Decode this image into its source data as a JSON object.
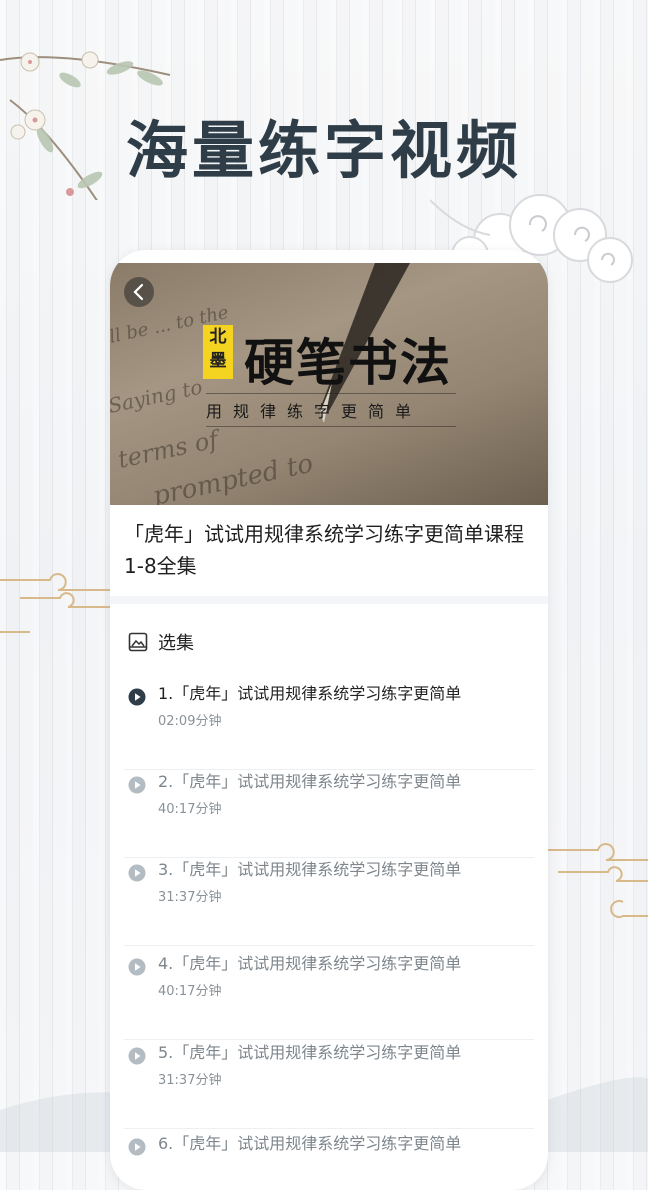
{
  "headline": "海量练字视频",
  "video": {
    "seal_text": "北墨",
    "title": "硬笔书法",
    "subtitle": "用规律练字更简单",
    "bg_words": [
      "Saying to",
      "terms of",
      "prompted to"
    ]
  },
  "course": {
    "title": "「虎年」试试用规律系统学习练字更简单课程1-8全集"
  },
  "episodes_section": {
    "label": "选集"
  },
  "episodes": [
    {
      "title": "1.「虎年」试试用规律系统学习练字更简单",
      "duration": "02:09分钟",
      "active": true
    },
    {
      "title": "2.「虎年」试试用规律系统学习练字更简单",
      "duration": "40:17分钟",
      "active": false
    },
    {
      "title": "3.「虎年」试试用规律系统学习练字更简单",
      "duration": "31:37分钟",
      "active": false
    },
    {
      "title": "4.「虎年」试试用规律系统学习练字更简单",
      "duration": "40:17分钟",
      "active": false
    },
    {
      "title": "5.「虎年」试试用规律系统学习练字更简单",
      "duration": "31:37分钟",
      "active": false
    },
    {
      "title": "6.「虎年」试试用规律系统学习练字更简单",
      "duration": "",
      "active": false
    }
  ],
  "icons": {
    "back": "chevron-left-icon",
    "section": "playlist-icon",
    "play": "play-circle-icon"
  },
  "colors": {
    "headline": "#2e3d47",
    "seal": "#f4d321",
    "active_play": "#2e3d47",
    "inactive_play": "#b3bcc2"
  }
}
